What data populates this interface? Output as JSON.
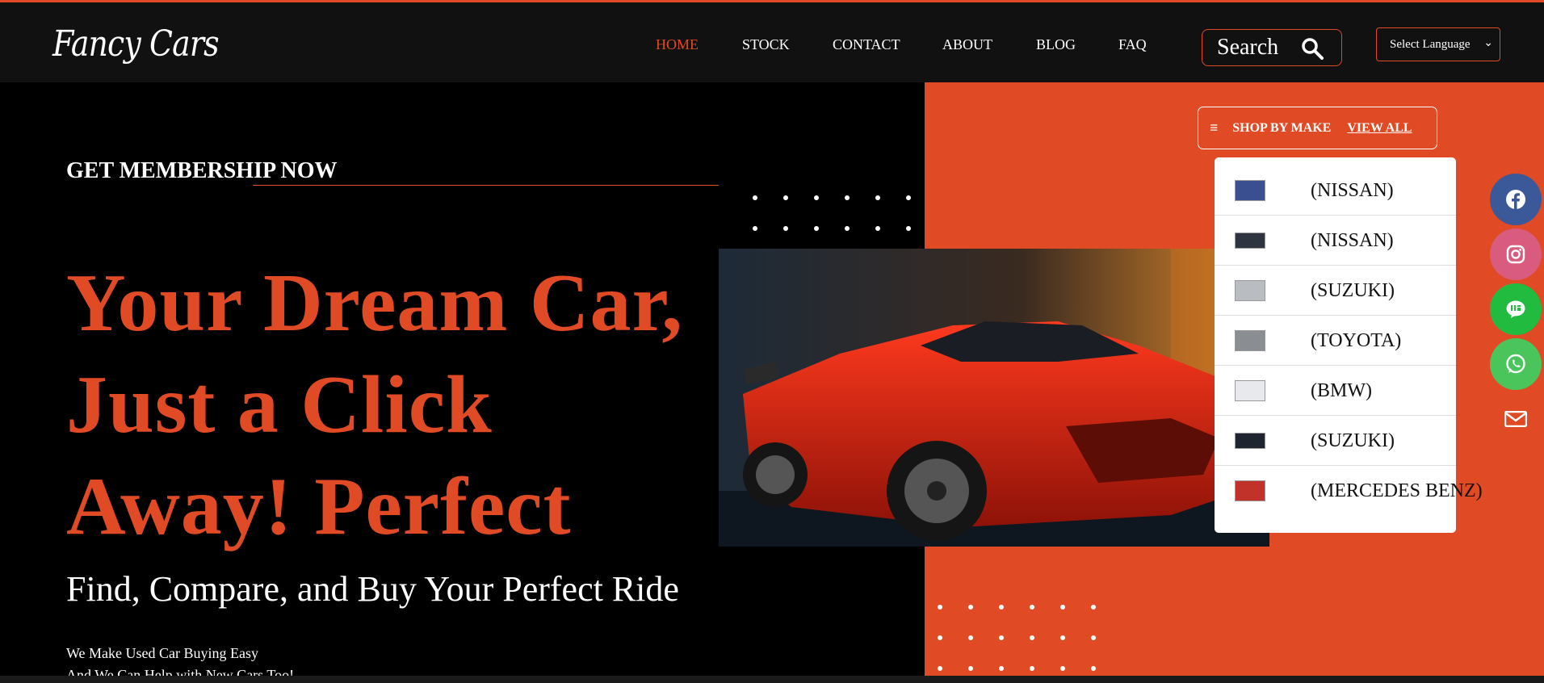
{
  "header": {
    "logo_text": "FANCY CARS",
    "nav": [
      {
        "label": "HOME",
        "active": true
      },
      {
        "label": "STOCK"
      },
      {
        "label": "CONTACT"
      },
      {
        "label": "ABOUT"
      },
      {
        "label": "BLOG"
      },
      {
        "label": "FAQ"
      }
    ],
    "search_label": "Search",
    "language_select": "Select Language"
  },
  "hero": {
    "membership": "GET MEMBERSHIP NOW",
    "headline_line1": "Your Dream Car,",
    "headline_line2": "Just a Click",
    "headline_line3": "Away! Perfect",
    "subheadline": "Find, Compare, and Buy Your Perfect Ride",
    "text_line1": "We Make Used Car Buying Easy",
    "text_line2": "And We Can Help with New Cars Too!"
  },
  "shop_by_make": {
    "title": "SHOP BY MAKE",
    "view_all": "VIEW ALL",
    "items": [
      {
        "label": "(NISSAN)",
        "thumb_color": "#3a4f8f"
      },
      {
        "label": "(NISSAN)",
        "thumb_color": "#2e3440"
      },
      {
        "label": "(SUZUKI)",
        "thumb_color": "#b9bdc2"
      },
      {
        "label": "(TOYOTA)",
        "thumb_color": "#8a8d92"
      },
      {
        "label": "(BMW)",
        "thumb_color": "#e7e9ec"
      },
      {
        "label": "(SUZUKI)",
        "thumb_color": "#1f2530"
      },
      {
        "label": "(MERCEDES BENZ)",
        "thumb_color": "#c0322a"
      }
    ]
  },
  "social": [
    {
      "name": "facebook",
      "color": "#3b5998"
    },
    {
      "name": "instagram",
      "color": "#d95b7d"
    },
    {
      "name": "line",
      "color": "#21bb3f"
    },
    {
      "name": "whatsapp",
      "color": "#49c55b"
    },
    {
      "name": "email",
      "color": "#e04a24"
    }
  ],
  "colors": {
    "accent": "#e04a24",
    "background": "#000000",
    "header": "#111111"
  }
}
